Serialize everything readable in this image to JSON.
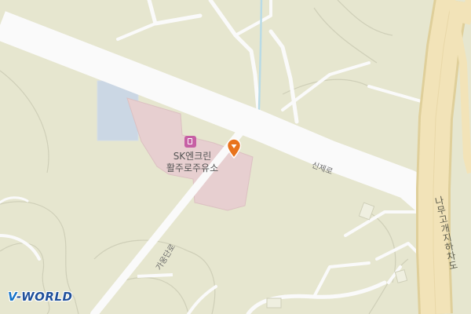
{
  "map": {
    "colors": {
      "land": "#e6e6cf",
      "road": "#fafafa",
      "highway_fill": "#f2e3b8",
      "highway_border": "#dfcf9a",
      "poi_area": "#e7cfd0",
      "water": "#cbd7e4",
      "stream": "#b9dbe6",
      "poi_icon": "#c65fa4",
      "marker": "#e8731c",
      "brand": "#1f4f9a"
    },
    "poi": {
      "icon": "gas-station-icon",
      "name_line1": "SK엔크린",
      "name_line2": "활주로주유소"
    },
    "marker": {
      "icon": "location-pin-icon"
    },
    "roads": {
      "main_road_label": "신제로",
      "side_road_label": "가웅단로",
      "highway_label": "나무고개지하차도"
    },
    "logo": {
      "prefix": "V",
      "suffix": "-WORLD"
    }
  }
}
